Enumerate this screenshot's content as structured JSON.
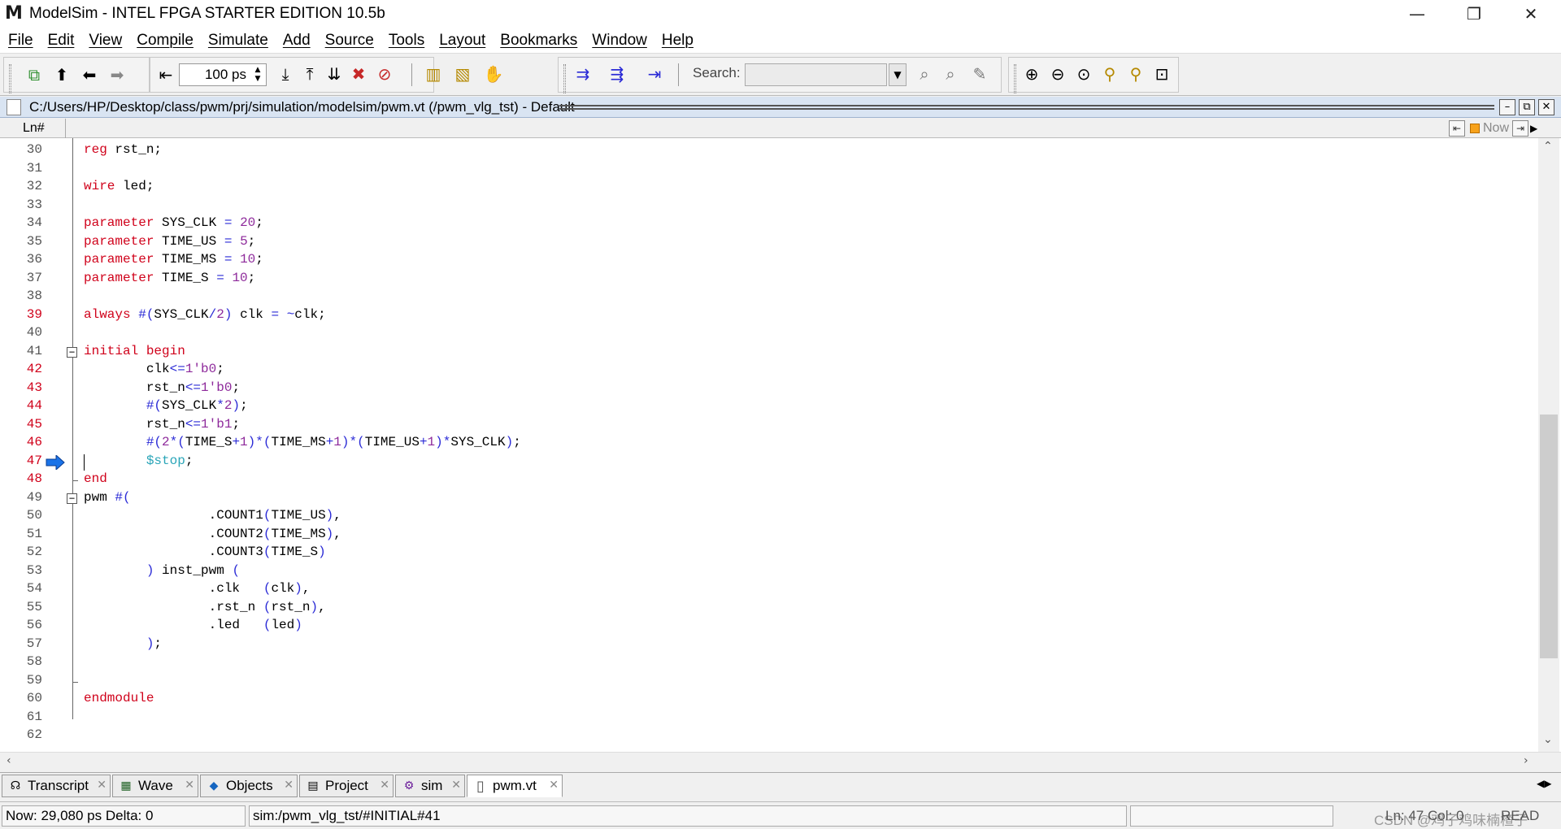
{
  "window": {
    "title": "ModelSim - INTEL FPGA STARTER EDITION 10.5b",
    "app_icon": "M",
    "controls": {
      "minimize": "—",
      "restore": "❐",
      "close": "✕"
    }
  },
  "menu": [
    "File",
    "Edit",
    "View",
    "Compile",
    "Simulate",
    "Add",
    "Source",
    "Tools",
    "Layout",
    "Bookmarks",
    "Window",
    "Help"
  ],
  "toolbar": {
    "run_length": "100 ps",
    "search_label": "Search:",
    "search_value": ""
  },
  "document": {
    "path": "C:/Users/HP/Desktop/class/pwm/prj/simulation/modelsim/pwm.vt (/pwm_vlg_tst) - Default",
    "column_label": "Ln#",
    "now_label": "Now"
  },
  "code_lines": [
    {
      "n": "30",
      "red": false,
      "code": "<span class=\"kw\">reg</span> rst_n;"
    },
    {
      "n": "31",
      "red": false,
      "code": ""
    },
    {
      "n": "32",
      "red": false,
      "code": "<span class=\"kw\">wire</span> led;"
    },
    {
      "n": "33",
      "red": false,
      "code": ""
    },
    {
      "n": "34",
      "red": false,
      "code": "<span class=\"kw\">parameter</span> SYS_CLK <span class=\"op\">=</span> <span class=\"num\">20</span>;"
    },
    {
      "n": "35",
      "red": false,
      "code": "<span class=\"kw\">parameter</span> TIME_US <span class=\"op\">=</span> <span class=\"num\">5</span>;"
    },
    {
      "n": "36",
      "red": false,
      "code": "<span class=\"kw\">parameter</span> TIME_MS <span class=\"op\">=</span> <span class=\"num\">10</span>;"
    },
    {
      "n": "37",
      "red": false,
      "code": "<span class=\"kw\">parameter</span> TIME_S <span class=\"op\">=</span> <span class=\"num\">10</span>;"
    },
    {
      "n": "38",
      "red": false,
      "code": ""
    },
    {
      "n": "39",
      "red": true,
      "code": "<span class=\"kw\">always</span> <span class=\"op\">#(</span>SYS_CLK<span class=\"op\">/</span><span class=\"num\">2</span><span class=\"op\">)</span> clk <span class=\"op\">= ~</span>clk;"
    },
    {
      "n": "40",
      "red": false,
      "code": ""
    },
    {
      "n": "41",
      "red": false,
      "code": "<span class=\"kw\">initial begin</span>"
    },
    {
      "n": "42",
      "red": true,
      "code": "        clk<span class=\"op\">&lt;=</span><span class=\"num\">1'b0</span>;"
    },
    {
      "n": "43",
      "red": true,
      "code": "        rst_n<span class=\"op\">&lt;=</span><span class=\"num\">1'b0</span>;"
    },
    {
      "n": "44",
      "red": true,
      "code": "        <span class=\"op\">#(</span>SYS_CLK<span class=\"op\">*</span><span class=\"num\">2</span><span class=\"op\">)</span>;"
    },
    {
      "n": "45",
      "red": true,
      "code": "        rst_n<span class=\"op\">&lt;=</span><span class=\"num\">1'b1</span>;"
    },
    {
      "n": "46",
      "red": true,
      "code": "        <span class=\"op\">#(</span><span class=\"num\">2</span><span class=\"op\">*(</span>TIME_S<span class=\"op\">+</span><span class=\"num\">1</span><span class=\"op\">)*(</span>TIME_MS<span class=\"op\">+</span><span class=\"num\">1</span><span class=\"op\">)*(</span>TIME_US<span class=\"op\">+</span><span class=\"num\">1</span><span class=\"op\">)*</span>SYS_CLK<span class=\"op\">)</span>;"
    },
    {
      "n": "47",
      "red": true,
      "code": "        <span class=\"sys\">$stop</span>;"
    },
    {
      "n": "48",
      "red": true,
      "code": "<span class=\"kw\">end</span>"
    },
    {
      "n": "49",
      "red": false,
      "code": "pwm <span class=\"op\">#(</span>"
    },
    {
      "n": "50",
      "red": false,
      "code": "                .COUNT1<span class=\"op\">(</span>TIME_US<span class=\"op\">)</span>,"
    },
    {
      "n": "51",
      "red": false,
      "code": "                .COUNT2<span class=\"op\">(</span>TIME_MS<span class=\"op\">)</span>,"
    },
    {
      "n": "52",
      "red": false,
      "code": "                .COUNT3<span class=\"op\">(</span>TIME_S<span class=\"op\">)</span>"
    },
    {
      "n": "53",
      "red": false,
      "code": "        <span class=\"op\">)</span> inst_pwm <span class=\"op\">(</span>"
    },
    {
      "n": "54",
      "red": false,
      "code": "                .clk   <span class=\"op\">(</span>clk<span class=\"op\">)</span>,"
    },
    {
      "n": "55",
      "red": false,
      "code": "                .rst_n <span class=\"op\">(</span>rst_n<span class=\"op\">)</span>,"
    },
    {
      "n": "56",
      "red": false,
      "code": "                .led   <span class=\"op\">(</span>led<span class=\"op\">)</span>"
    },
    {
      "n": "57",
      "red": false,
      "code": "        <span class=\"op\">)</span>;"
    },
    {
      "n": "58",
      "red": false,
      "code": ""
    },
    {
      "n": "59",
      "red": false,
      "code": ""
    },
    {
      "n": "60",
      "red": false,
      "code": "<span class=\"kw\">endmodule</span>"
    },
    {
      "n": "61",
      "red": false,
      "code": ""
    },
    {
      "n": "62",
      "red": false,
      "code": ""
    }
  ],
  "tabs": [
    {
      "label": "Transcript",
      "icon": "transcript-icon",
      "glyph": "☊",
      "active": false
    },
    {
      "label": "Wave",
      "icon": "wave-icon",
      "glyph": "▦",
      "active": false
    },
    {
      "label": "Objects",
      "icon": "objects-icon",
      "glyph": "◆",
      "active": false
    },
    {
      "label": "Project",
      "icon": "project-icon",
      "glyph": "▤",
      "active": false
    },
    {
      "label": "sim",
      "icon": "sim-icon",
      "glyph": "⚙",
      "active": false
    },
    {
      "label": "pwm.vt",
      "icon": "file-icon",
      "glyph": "▯",
      "active": true
    }
  ],
  "status": {
    "now": "Now: 29,080 ps  Delta: 0",
    "context": "sim:/pwm_vlg_tst/#INITIAL#41",
    "watermark": "CSDN @鸡子鸡味楠楂子",
    "position": "Ln: 47  Col: 0",
    "mode": "READ"
  },
  "colors": {
    "keyword": "#d0021b",
    "number": "#8e2a9b",
    "operator": "#2b2bd6",
    "system_task": "#2aa5b8",
    "exec_arrow": "#1a73e8"
  }
}
